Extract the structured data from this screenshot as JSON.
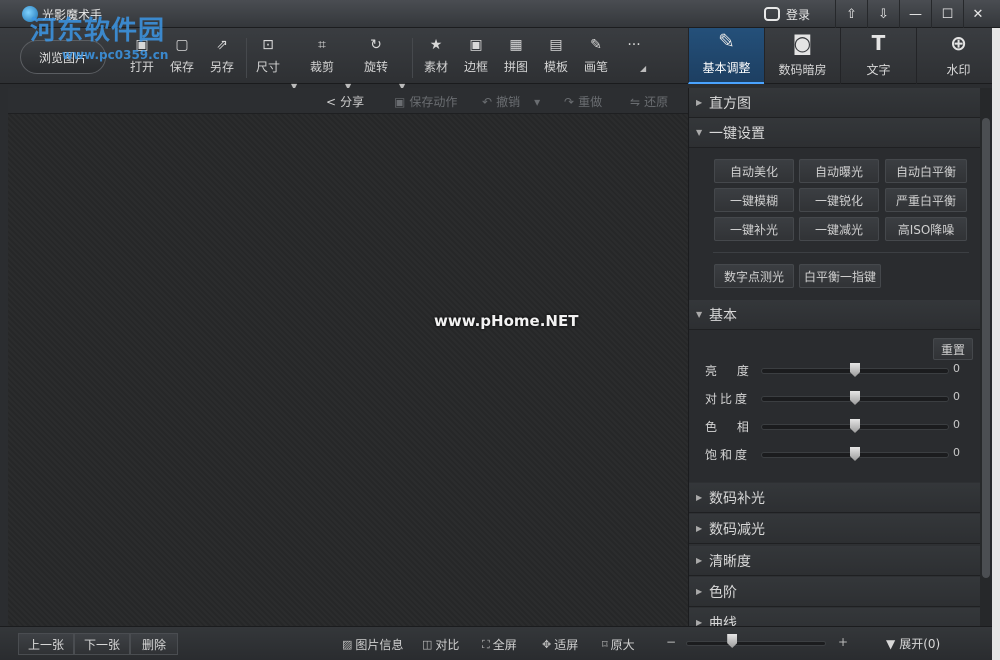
{
  "window": {
    "title": "光影魔术手",
    "login_label": "登录",
    "watermark_text": "河东软件园",
    "watermark_url": "www.pc0359.cn",
    "win_buttons": [
      "⇧",
      "⇩",
      "—",
      "☐",
      "✕"
    ]
  },
  "toolbar": {
    "open_picture": "浏览图片",
    "tools": [
      {
        "label": "打开",
        "icon": "open-icon",
        "glyph": "▣"
      },
      {
        "label": "保存",
        "icon": "save-icon",
        "glyph": "▢"
      },
      {
        "label": "另存",
        "icon": "save-as-icon",
        "glyph": "⇗"
      },
      {
        "label": "尺寸",
        "icon": "resize-icon",
        "glyph": "⊡"
      },
      {
        "label": "裁剪",
        "icon": "crop-icon",
        "glyph": "⌗"
      },
      {
        "label": "旋转",
        "icon": "rotate-icon",
        "glyph": "↻"
      },
      {
        "label": "素材",
        "icon": "material-icon",
        "glyph": "★"
      },
      {
        "label": "边框",
        "icon": "border-icon",
        "glyph": "▣"
      },
      {
        "label": "拼图",
        "icon": "collage-icon",
        "glyph": "▦"
      },
      {
        "label": "模板",
        "icon": "template-icon",
        "glyph": "▤"
      },
      {
        "label": "画笔",
        "icon": "brush-icon",
        "glyph": "✎"
      },
      {
        "label": "",
        "icon": "more-icon",
        "glyph": "···"
      }
    ]
  },
  "tabs": [
    {
      "label": "基本调整",
      "glyph": "✎",
      "active": true
    },
    {
      "label": "数码暗房",
      "glyph": "◙",
      "active": false
    },
    {
      "label": "文字",
      "glyph": "T",
      "active": false
    },
    {
      "label": "水印",
      "glyph": "⊕",
      "active": false
    }
  ],
  "subbar": {
    "share": "分享",
    "save_action": "保存动作",
    "undo": "撤销",
    "redo": "重做",
    "restore": "还原"
  },
  "canvas": {
    "watermark": "www.pHome.NET"
  },
  "panel": {
    "histogram": "直方图",
    "one_click": "一键设置",
    "one_click_buttons": [
      [
        "自动美化",
        "自动曝光",
        "自动白平衡"
      ],
      [
        "一键模糊",
        "一键锐化",
        "严重白平衡"
      ],
      [
        "一键补光",
        "一键减光",
        "高ISO降噪"
      ]
    ],
    "extra_buttons": [
      "数字点测光",
      "白平衡一指键"
    ],
    "basic": "基本",
    "reset": "重置",
    "sliders": [
      {
        "label": "亮 度",
        "value": "0",
        "level": 0.5
      },
      {
        "label": "对比度",
        "value": "0",
        "level": 0.5
      },
      {
        "label": "色 相",
        "value": "0",
        "level": 0.5
      },
      {
        "label": "饱和度",
        "value": "0",
        "level": 0.5
      }
    ],
    "collapsed_sections": [
      "数码补光",
      "数码减光",
      "清晰度",
      "色阶",
      "曲线"
    ]
  },
  "bottom": {
    "prev": "上一张",
    "next": "下一张",
    "delete": "删除",
    "info": "图片信息",
    "compare": "对比",
    "fullscreen": "全屏",
    "fit": "适屏",
    "original": "原大",
    "zoom_level": 0.33,
    "expand": "展开(0)"
  }
}
